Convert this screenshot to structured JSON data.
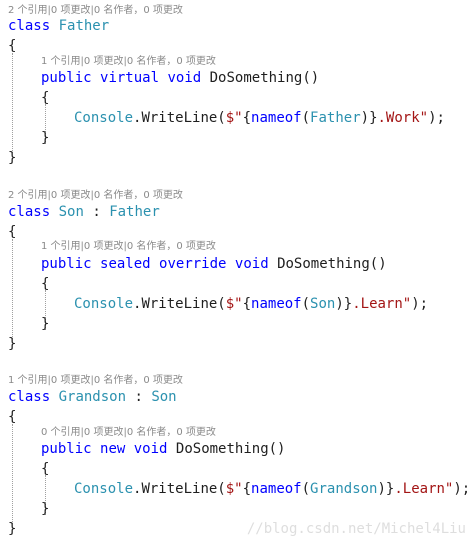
{
  "lens": {
    "father_class": "2 个引用|0 项更改|0 名作者，0 项更改",
    "father_method": "1 个引用|0 项更改|0 名作者，0 项更改",
    "son_class": "2 个引用|0 项更改|0 名作者，0 项更改",
    "son_method": "1 个引用|0 项更改|0 名作者，0 项更改",
    "grandson_class": "1 个引用|0 项更改|0 名作者，0 项更改",
    "grandson_method": "0 个引用|0 项更改|0 名作者，0 项更改"
  },
  "tokens": {
    "class": "class",
    "public": "public",
    "virtual": "virtual",
    "sealed": "sealed",
    "override": "override",
    "new": "new",
    "void": "void",
    "nameof": "nameof",
    "colon": " : ",
    "open_brace": "{",
    "close_brace": "}",
    "method_name": "DoSomething()",
    "console": "Console",
    "writeline": ".WriteLine(",
    "interp_prefix": "$\"",
    "open_interp": "{",
    "paren_open": "(",
    "paren_close": ")",
    "close_interp": "}",
    "call_end": ");"
  },
  "classes": {
    "father": "Father",
    "son": "Son",
    "grandson": "Grandson"
  },
  "strings": {
    "father_suffix": ".Work\"",
    "son_suffix": ".Learn\"",
    "grandson_suffix": ".Learn\""
  },
  "watermark": "//blog.csdn.net/Michel4Liu"
}
